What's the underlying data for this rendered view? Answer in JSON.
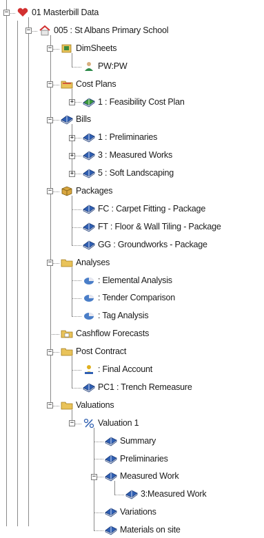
{
  "tree": {
    "nodes": [
      {
        "id": "n0",
        "depth": 0,
        "label": "01 Masterbill Data",
        "icon": "masterbill-heart-icon",
        "expander": "minus"
      },
      {
        "id": "n1",
        "depth": 1,
        "label": "005 : St Albans Primary School",
        "icon": "project-house-icon",
        "expander": "minus"
      },
      {
        "id": "n2",
        "depth": 2,
        "label": "DimSheets",
        "icon": "dimsheets-folder-icon",
        "expander": "minus"
      },
      {
        "id": "n3",
        "depth": 3,
        "label": "PW:PW",
        "icon": "user-icon",
        "expander": "none"
      },
      {
        "id": "n4",
        "depth": 2,
        "label": "Cost Plans",
        "icon": "cost-plans-folder-icon",
        "expander": "minus"
      },
      {
        "id": "n5",
        "depth": 3,
        "label": "1 : Feasibility Cost Plan",
        "icon": "green-book-icon",
        "expander": "plus"
      },
      {
        "id": "n6",
        "depth": 2,
        "label": "Bills",
        "icon": "blue-book-icon",
        "expander": "minus"
      },
      {
        "id": "n7",
        "depth": 3,
        "label": "1 : Preliminaries",
        "icon": "blue-book-icon",
        "expander": "plus"
      },
      {
        "id": "n8",
        "depth": 3,
        "label": "3 : Measured Works",
        "icon": "blue-book-icon",
        "expander": "plus"
      },
      {
        "id": "n9",
        "depth": 3,
        "label": "5 : Soft Landscaping",
        "icon": "blue-book-icon",
        "expander": "plus"
      },
      {
        "id": "n10",
        "depth": 2,
        "label": "Packages",
        "icon": "packages-box-icon",
        "expander": "minus"
      },
      {
        "id": "n11",
        "depth": 3,
        "label": "FC : Carpet Fitting - Package",
        "icon": "blue-book-icon",
        "expander": "none"
      },
      {
        "id": "n12",
        "depth": 3,
        "label": "FT : Floor & Wall Tiling - Package",
        "icon": "blue-book-icon",
        "expander": "none"
      },
      {
        "id": "n13",
        "depth": 3,
        "label": "GG : Groundworks - Package",
        "icon": "blue-book-icon",
        "expander": "none"
      },
      {
        "id": "n14",
        "depth": 2,
        "label": "Analyses",
        "icon": "analyses-folder-icon",
        "expander": "minus"
      },
      {
        "id": "n15",
        "depth": 3,
        "label": " : Elemental Analysis",
        "icon": "pie-chart-icon",
        "expander": "none"
      },
      {
        "id": "n16",
        "depth": 3,
        "label": " : Tender Comparison",
        "icon": "pie-chart-icon",
        "expander": "none"
      },
      {
        "id": "n17",
        "depth": 3,
        "label": " : Tag Analysis",
        "icon": "pie-chart-icon",
        "expander": "none"
      },
      {
        "id": "n18",
        "depth": 2,
        "label": "Cashflow Forecasts",
        "icon": "cashflow-folder-icon",
        "expander": "none"
      },
      {
        "id": "n19",
        "depth": 2,
        "label": "Post Contract",
        "icon": "post-contract-folder-icon",
        "expander": "minus"
      },
      {
        "id": "n20",
        "depth": 3,
        "label": " : Final Account",
        "icon": "final-account-icon",
        "expander": "none"
      },
      {
        "id": "n21",
        "depth": 3,
        "label": "PC1 : Trench Remeasure",
        "icon": "blue-book-icon",
        "expander": "none"
      },
      {
        "id": "n22",
        "depth": 2,
        "label": "Valuations",
        "icon": "valuations-folder-icon",
        "expander": "minus"
      },
      {
        "id": "n23",
        "depth": 3,
        "label": "Valuation 1",
        "icon": "valuation-percent-icon",
        "expander": "minus"
      },
      {
        "id": "n24",
        "depth": 4,
        "label": "Summary",
        "icon": "blue-book-icon",
        "expander": "none"
      },
      {
        "id": "n25",
        "depth": 4,
        "label": "Preliminaries",
        "icon": "blue-book-icon",
        "expander": "none"
      },
      {
        "id": "n26",
        "depth": 4,
        "label": "Measured Work",
        "icon": "blue-book-icon",
        "expander": "minus"
      },
      {
        "id": "n27",
        "depth": 5,
        "label": "3:Measured Work",
        "icon": "blue-book-icon",
        "expander": "none"
      },
      {
        "id": "n28",
        "depth": 4,
        "label": "Variations",
        "icon": "blue-book-icon",
        "expander": "none"
      },
      {
        "id": "n29",
        "depth": 4,
        "label": "Materials on site",
        "icon": "blue-book-icon",
        "expander": "none"
      }
    ]
  },
  "colors": {
    "line": "#8a8a8a",
    "book_blue": "#2f5fb3",
    "book_green": "#3c9a3c",
    "folder": "#e9c35a",
    "heart_red": "#d23030"
  }
}
